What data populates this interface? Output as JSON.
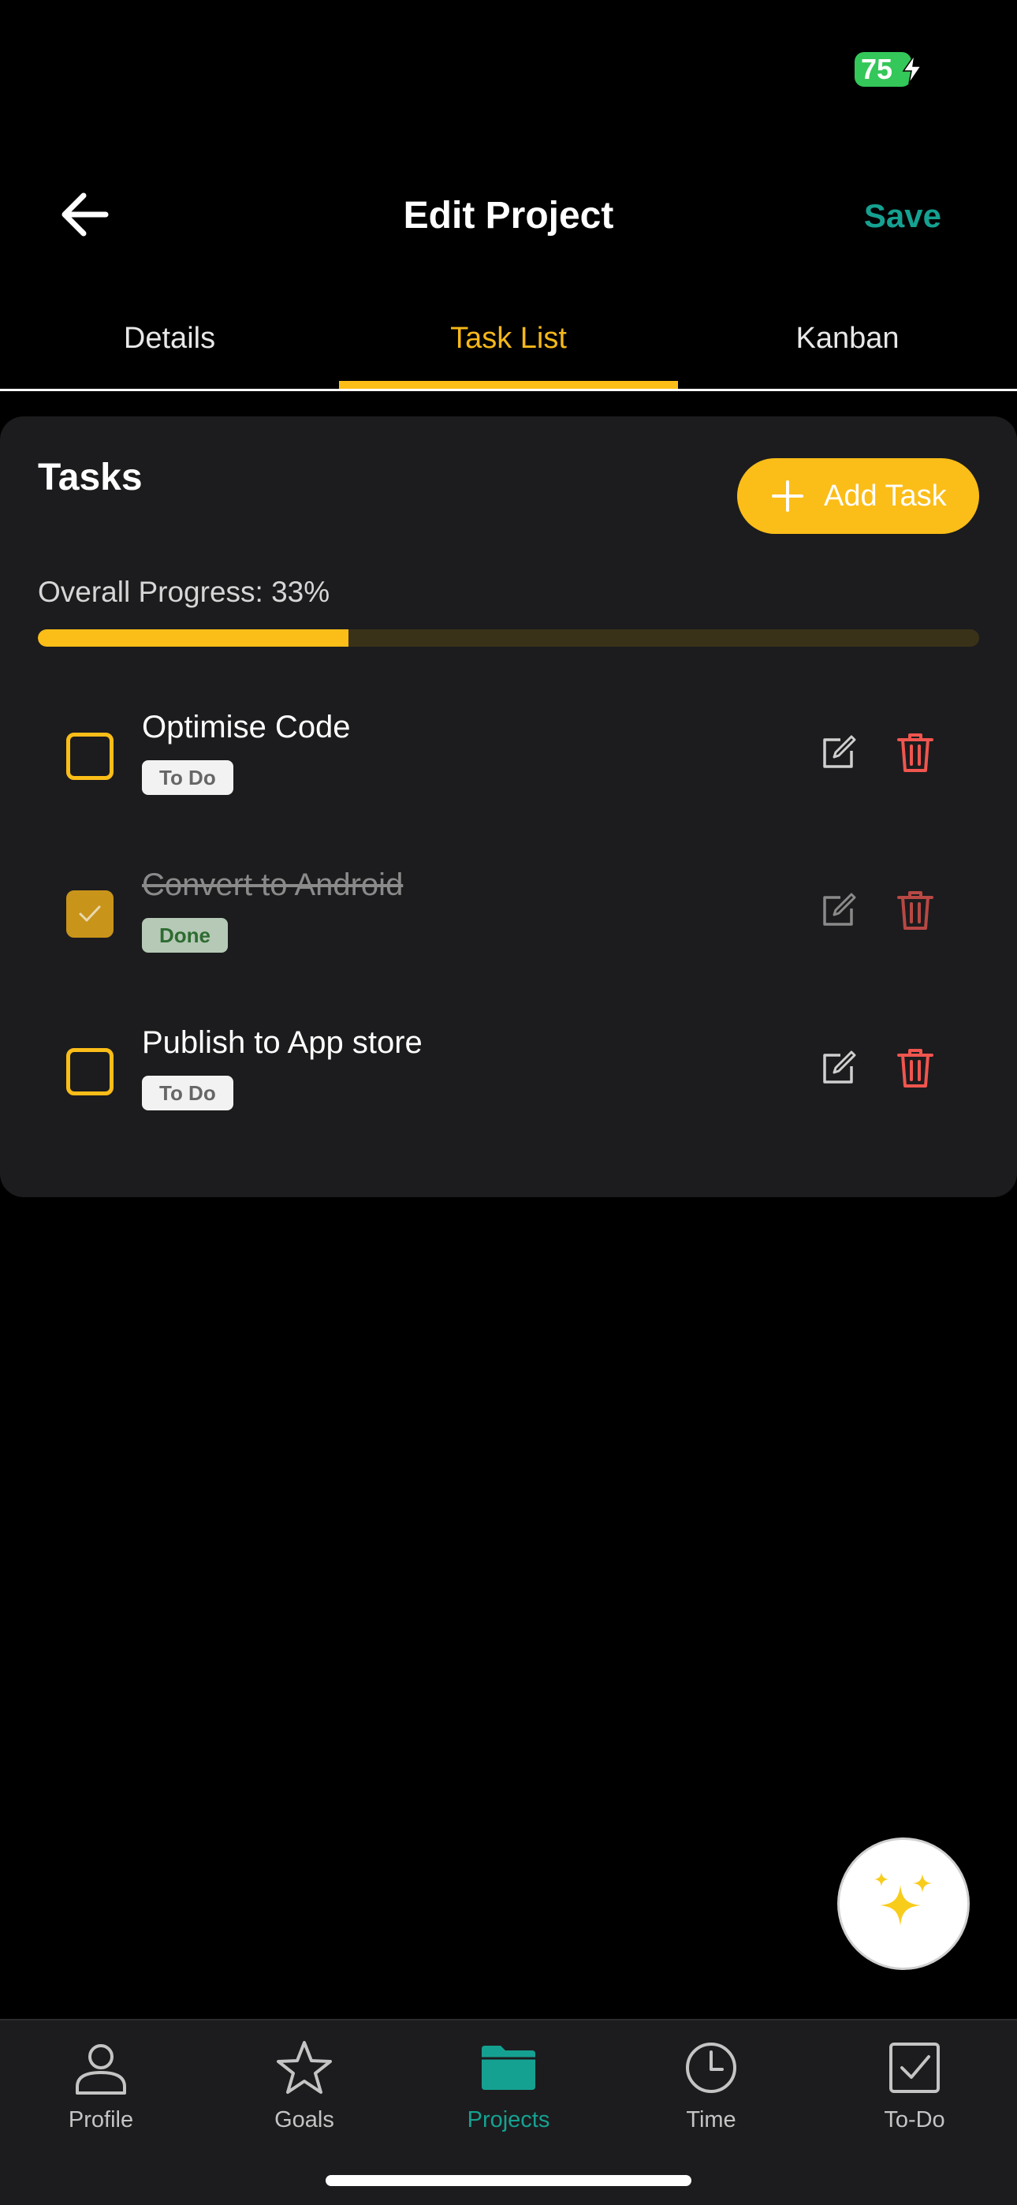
{
  "status_bar": {
    "battery": "75"
  },
  "header": {
    "title": "Edit Project",
    "save_label": "Save"
  },
  "tabs": [
    {
      "label": "Details",
      "active": false
    },
    {
      "label": "Task List",
      "active": true
    },
    {
      "label": "Kanban",
      "active": false
    }
  ],
  "tasks_section": {
    "title": "Tasks",
    "add_button_label": "Add Task",
    "progress_label": "Overall Progress: 33%",
    "progress_percent": 33
  },
  "tasks": [
    {
      "name": "Optimise Code",
      "status": "To Do",
      "completed": false
    },
    {
      "name": "Convert to Android",
      "status": "Done",
      "completed": true
    },
    {
      "name": "Publish to App store",
      "status": "To Do",
      "completed": false
    }
  ],
  "bottom_nav": [
    {
      "label": "Profile",
      "icon": "person-icon",
      "active": false
    },
    {
      "label": "Goals",
      "icon": "star-icon",
      "active": false
    },
    {
      "label": "Projects",
      "icon": "folder-icon",
      "active": true
    },
    {
      "label": "Time",
      "icon": "clock-icon",
      "active": false
    },
    {
      "label": "To-Do",
      "icon": "checkbox-icon",
      "active": false
    }
  ],
  "colors": {
    "accent": "#fbbd18",
    "save": "#15a191",
    "delete": "#f0554f",
    "background": "#000000",
    "card": "#1c1c1e"
  }
}
